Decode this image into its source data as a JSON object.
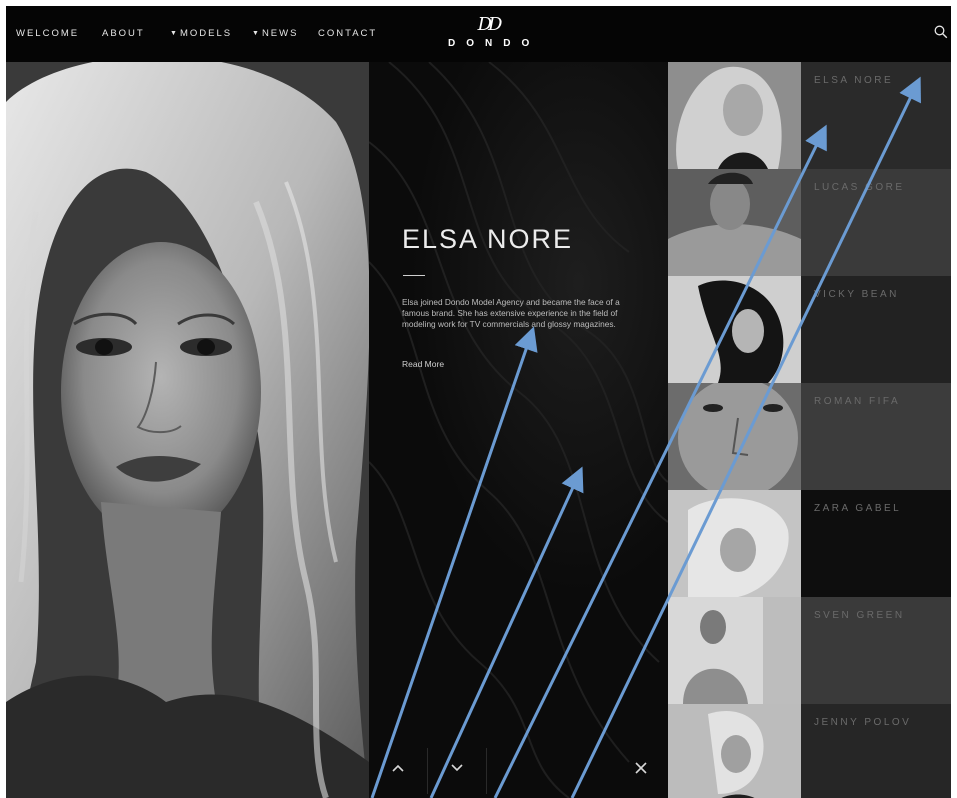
{
  "nav": {
    "items": [
      {
        "label": "WELCOME",
        "caret": false
      },
      {
        "label": "ABOUT",
        "caret": false
      },
      {
        "label": "MODELS",
        "caret": true
      },
      {
        "label": "NEWS",
        "caret": true
      },
      {
        "label": "CONTACT",
        "caret": false
      }
    ],
    "logo_mark": "DD",
    "logo_text": "DONDO",
    "search_icon": "search-icon"
  },
  "featured": {
    "name": "ELSA NORE",
    "bio": "Elsa joined Dondo Model Agency and became the face of a famous brand. She has extensive experience in the field of modeling work for TV commercials and glossy magazines.",
    "read_more": "Read More"
  },
  "controls": {
    "up_icon": "chevron-up-icon",
    "down_icon": "chevron-down-icon",
    "close_icon": "close-icon"
  },
  "models": [
    {
      "name": "ELSA NORE"
    },
    {
      "name": "LUCAS GORE"
    },
    {
      "name": "VICKY BEAN"
    },
    {
      "name": "ROMAN FIFA"
    },
    {
      "name": "ZARA GABEL"
    },
    {
      "name": "SVEN GREEN"
    },
    {
      "name": "JENNY POLOV"
    }
  ],
  "colors": {
    "annotation_arrow": "#6b9bd2",
    "background": "#000000",
    "text_primary": "#ececec",
    "name_text": "#6a6a6a"
  }
}
